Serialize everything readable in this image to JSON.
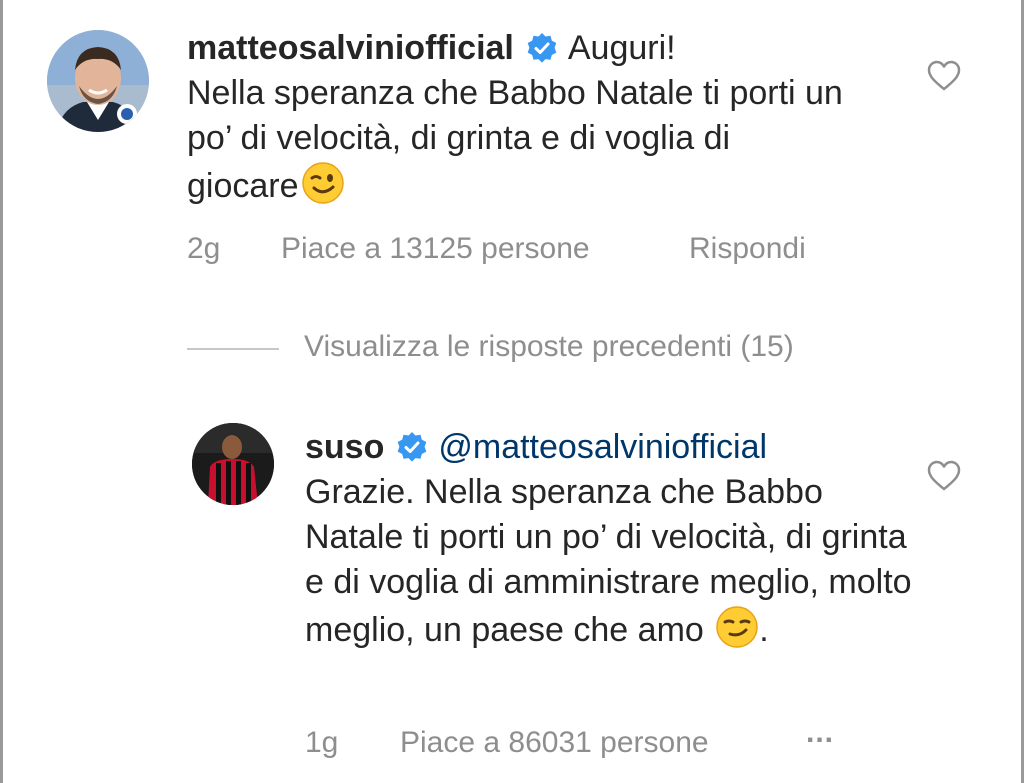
{
  "comment": {
    "username": "matteosalviniofficial",
    "text_line_1": "Auguri!",
    "text_rest": "Nella speranza che Babbo Natale ti porti un po’ di velocità, di grinta e di voglia di giocare",
    "emoji": "winking-face",
    "time": "2g",
    "likes": "Piace a 13125 persone",
    "reply_label": "Rispondi"
  },
  "replies_link": "Visualizza le risposte precedenti (15)",
  "reply": {
    "username": "suso",
    "mention": "@matteosalviniofficial",
    "text": "Grazie. Nella speranza che Babbo Natale ti porti un po’ di velocità, di grinta e di voglia di amministrare meglio, molto meglio, un paese che amo",
    "emoji": "smirking-face",
    "text_end": ".",
    "time": "1g",
    "likes": "Piace a 86031 persone",
    "more": "..."
  },
  "colors": {
    "verified_blue": "#3897f0",
    "meta_gray": "#8e8e8e",
    "mention_blue": "#00376b"
  }
}
